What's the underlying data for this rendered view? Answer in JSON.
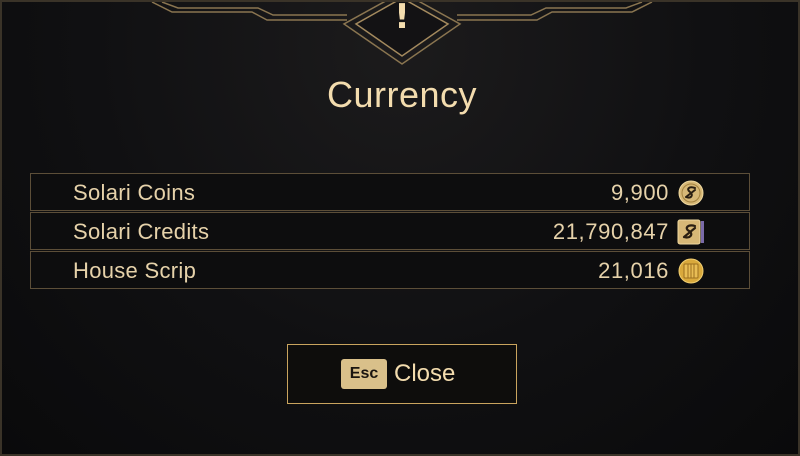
{
  "dialog": {
    "title": "Currency",
    "alert_glyph": "!"
  },
  "currencies": [
    {
      "name": "Solari Coins",
      "amount": "9,900",
      "icon": "solari-coin-icon"
    },
    {
      "name": "Solari Credits",
      "amount": "21,790,847",
      "icon": "solari-credit-icon"
    },
    {
      "name": "House Scrip",
      "amount": "21,016",
      "icon": "house-scrip-icon"
    }
  ],
  "close": {
    "key": "Esc",
    "label": "Close"
  },
  "colors": {
    "accent": "#f3dcae",
    "border": "#5c4e38",
    "button_border": "#c9a45e",
    "background": "#0c0c0e"
  }
}
